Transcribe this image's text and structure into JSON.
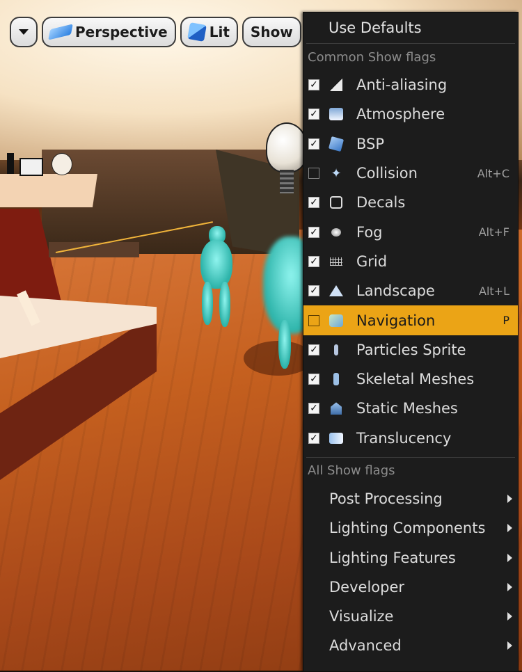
{
  "toolbar": {
    "options_icon": "chevron-down-icon",
    "perspective_label": "Perspective",
    "lit_label": "Lit",
    "show_label": "Show"
  },
  "menu": {
    "use_defaults": "Use Defaults",
    "common_header": "Common Show flags",
    "flags": [
      {
        "label": "Anti-aliasing",
        "checked": true,
        "shortcut": "",
        "icon": "anti-aliasing-icon"
      },
      {
        "label": "Atmosphere",
        "checked": true,
        "shortcut": "",
        "icon": "atmosphere-icon"
      },
      {
        "label": "BSP",
        "checked": true,
        "shortcut": "",
        "icon": "bsp-icon"
      },
      {
        "label": "Collision",
        "checked": false,
        "shortcut": "Alt+C",
        "icon": "collision-icon"
      },
      {
        "label": "Decals",
        "checked": true,
        "shortcut": "",
        "icon": "decals-icon"
      },
      {
        "label": "Fog",
        "checked": true,
        "shortcut": "Alt+F",
        "icon": "fog-icon"
      },
      {
        "label": "Grid",
        "checked": true,
        "shortcut": "",
        "icon": "grid-icon"
      },
      {
        "label": "Landscape",
        "checked": true,
        "shortcut": "Alt+L",
        "icon": "landscape-icon"
      },
      {
        "label": "Navigation",
        "checked": false,
        "shortcut": "P",
        "icon": "navigation-icon",
        "highlighted": true
      },
      {
        "label": "Particles Sprite",
        "checked": true,
        "shortcut": "",
        "icon": "particles-icon"
      },
      {
        "label": "Skeletal Meshes",
        "checked": true,
        "shortcut": "",
        "icon": "skeletal-mesh-icon"
      },
      {
        "label": "Static Meshes",
        "checked": true,
        "shortcut": "",
        "icon": "static-mesh-icon"
      },
      {
        "label": "Translucency",
        "checked": true,
        "shortcut": "",
        "icon": "translucency-icon"
      }
    ],
    "all_header": "All Show flags",
    "submenus": [
      "Post Processing",
      "Lighting Components",
      "Lighting Features",
      "Developer",
      "Visualize",
      "Advanced"
    ],
    "highlight_color": "#eba416",
    "background_color": "#1c1c1c"
  }
}
